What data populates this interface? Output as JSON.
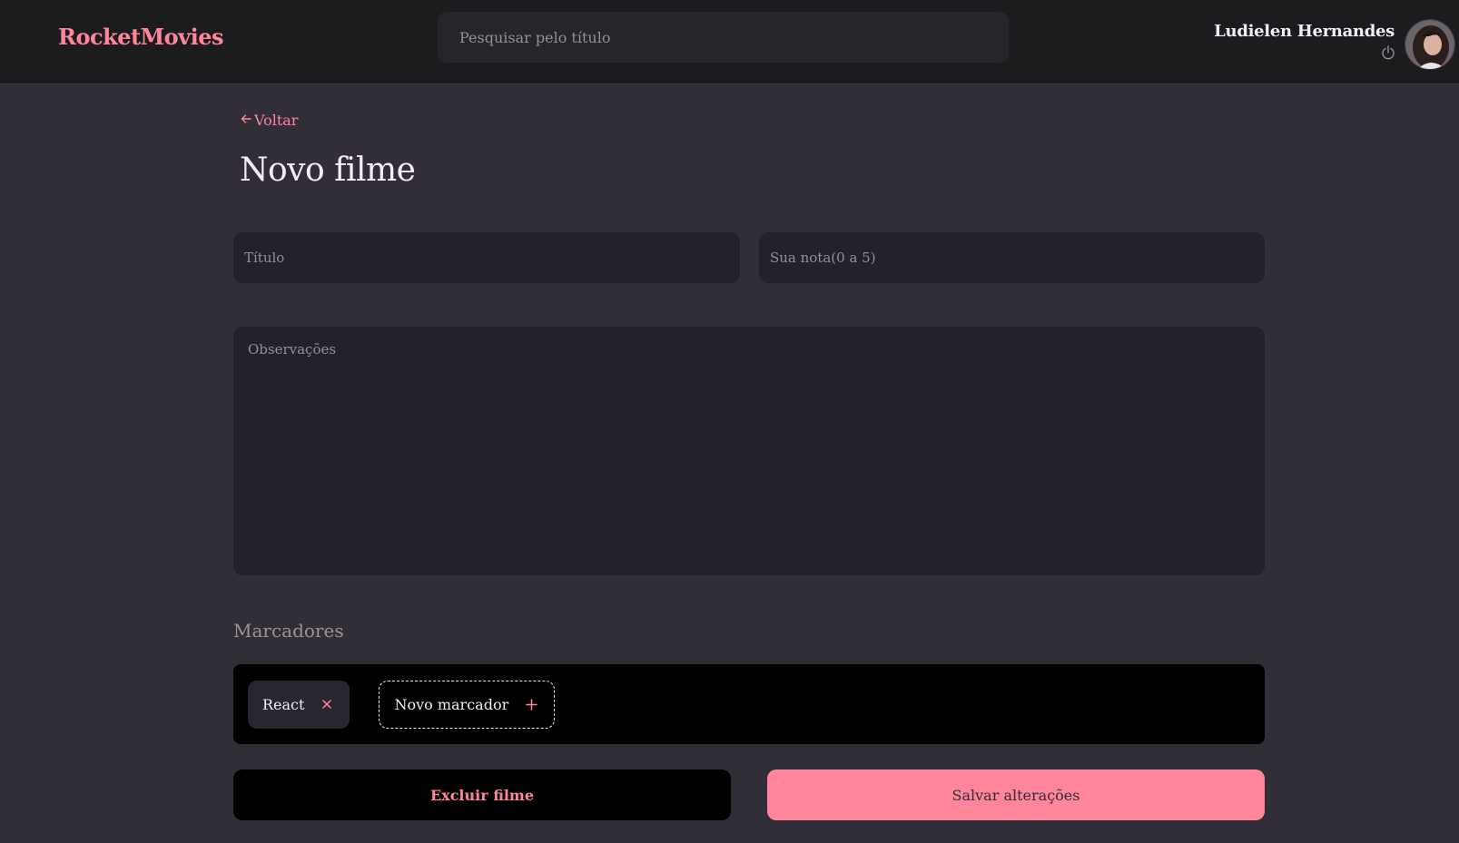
{
  "header": {
    "brand": "RocketMovies",
    "search_placeholder": "Pesquisar pelo título",
    "user_name": "Ludielen Hernandes",
    "logout_icon": "power-icon",
    "avatar_icon": "user-avatar"
  },
  "navigation": {
    "back_label": "Voltar",
    "back_icon": "arrow-left-icon"
  },
  "form": {
    "page_title": "Novo filme",
    "title_placeholder": "Título",
    "title_value": "",
    "rating_placeholder": "Sua nota(0 a 5)",
    "rating_value": "",
    "notes_placeholder": "Observações",
    "notes_value": ""
  },
  "tags": {
    "section_title": "Marcadores",
    "items": [
      {
        "label": "React",
        "icon": "close-icon"
      }
    ],
    "new_tag_placeholder": "Novo marcador",
    "new_tag_icon": "plus-icon"
  },
  "actions": {
    "delete_label": "Excluir filme",
    "save_label": "Salvar alterações"
  },
  "colors": {
    "accent": "#ff859b",
    "background": "#312e38",
    "header_bg": "#1c1b1e",
    "input_bg": "#232129",
    "text": "#f4edf8",
    "placeholder": "#948f99"
  }
}
